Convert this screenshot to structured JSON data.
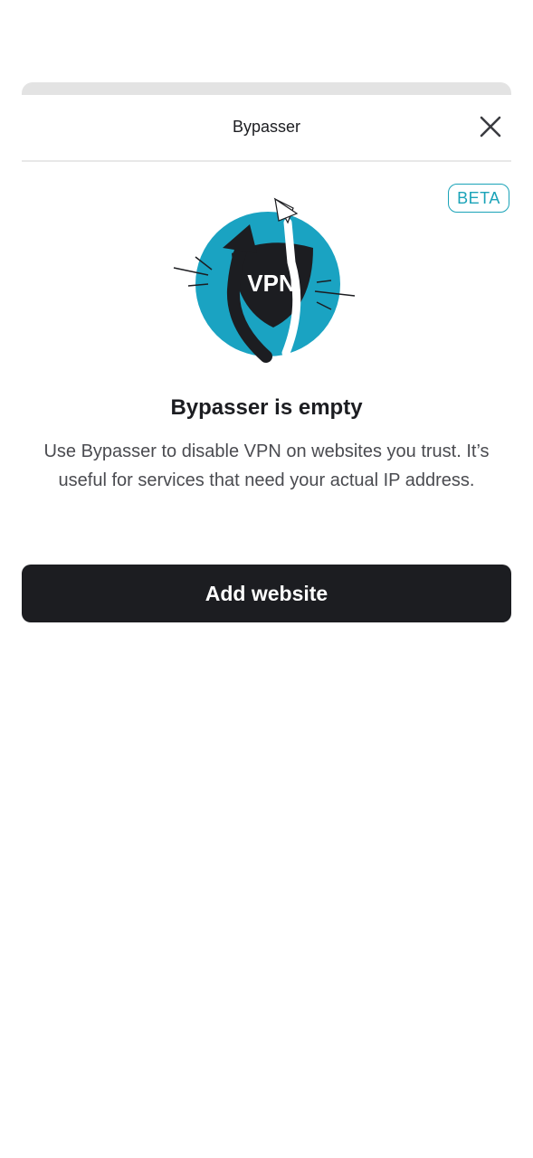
{
  "header": {
    "title": "Bypasser"
  },
  "badge": {
    "label": "BETA"
  },
  "illustration": {
    "shield_text": "VPN",
    "colors": {
      "circle": "#1aa3c2",
      "shield": "#1c1d21",
      "arrow_dark": "#1c1d21",
      "arrow_light": "#ffffff"
    }
  },
  "empty_state": {
    "title": "Bypasser is empty",
    "description": "Use Bypasser to disable VPN on websites you trust. It’s useful for services that need your actual IP address."
  },
  "actions": {
    "add_website_label": "Add website"
  },
  "colors": {
    "accent": "#1aa3b8",
    "primary_button": "#1c1d21",
    "divider": "#e8e8e8"
  }
}
